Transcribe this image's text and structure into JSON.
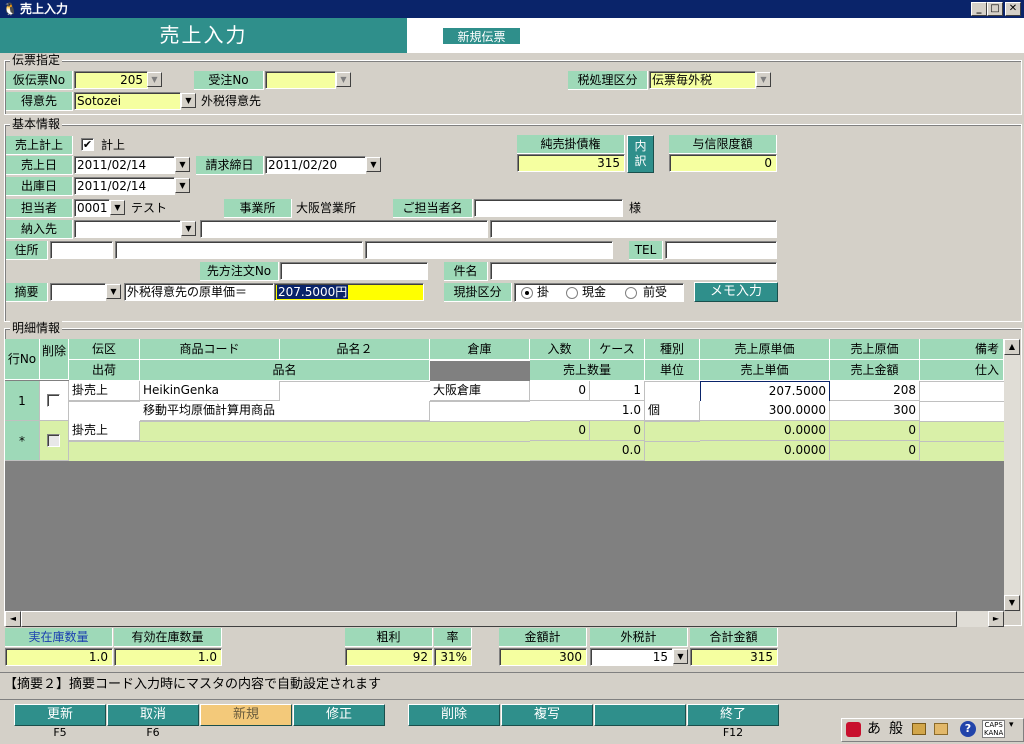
{
  "window": {
    "title": "売上入力",
    "minimize": "_",
    "restore": "□",
    "close": "✕"
  },
  "header": {
    "title": "売上入力",
    "new_badge": "新規伝票"
  },
  "denpyo": {
    "group": "伝票指定",
    "kari_no_label": "仮伝票No",
    "kari_no": "205",
    "juchu_label": "受注No",
    "juchu": "",
    "zei_label": "税処理区分",
    "zei": "伝票毎外税",
    "tokui_label": "得意先",
    "tokui": "Sotozei",
    "tokui_name": "外税得意先"
  },
  "kihon": {
    "group": "基本情報",
    "keijo_label": "売上計上",
    "keijo_check": "✔",
    "keijo_text": "計上",
    "junkake_label": "純売掛債権",
    "junkake": "315",
    "uchiwake": "内\n訳",
    "yoshin_label": "与信限度額",
    "yoshin": "0",
    "uriage_label": "売上日",
    "uriage": "2011/02/14",
    "seikyu_label": "請求締日",
    "seikyu": "2011/02/20",
    "shukko_label": "出庫日",
    "shukko": "2011/02/14",
    "tanto_label": "担当者",
    "tanto_code": "0001",
    "tanto_name": "テスト",
    "jigyo_label": "事業所",
    "jigyo": "大阪営業所",
    "gotanto_label": "ご担当者名",
    "gotanto": "",
    "sama": "様",
    "nonyu_label": "納入先",
    "jusho_label": "住所",
    "tel_label": "TEL",
    "sakichu_label": "先方注文No",
    "kenmei_label": "件名",
    "tekiyo_label": "摘要",
    "tekiyo_text": "外税得意先の原単価＝",
    "tekiyo_value": "207.5000円",
    "genkake_label": "現掛区分",
    "genkake_opts": [
      "掛",
      "現金",
      "前受"
    ],
    "memo_btn": "メモ入力"
  },
  "meisai": {
    "group": "明細情報",
    "hd": {
      "gyo": "行No",
      "sakujo": "削除",
      "denku": "伝区",
      "shohin": "商品コード",
      "hinmei2": "品名２",
      "soko": "倉庫",
      "irisu": "入数",
      "case": "ケース",
      "shubetsu": "種別",
      "genka_tanka": "売上原単価",
      "genka": "売上原価",
      "biko": "備考",
      "shukka": "出荷",
      "hinmei": "品名",
      "suryo": "売上数量",
      "tani": "単位",
      "tanka": "売上単価",
      "kingaku": "売上金額",
      "shiire": "仕入"
    },
    "rows": [
      {
        "no": "1",
        "denku": "掛売上",
        "code": "HeikinGenka",
        "soko": "大阪倉庫",
        "irisu": "0",
        "case": "1",
        "genka_tanka": "207.5000",
        "genka": "208",
        "hinmei": "移動平均原価計算用商品",
        "suryo": "1.0",
        "tani": "個",
        "tanka": "300.0000",
        "kingaku": "300"
      },
      {
        "no": "*",
        "denku": "掛売上",
        "irisu": "0",
        "case": "0",
        "genka_tanka": "0.0000",
        "genka": "0",
        "suryo": "0.0",
        "tanka": "0.0000",
        "kingaku": "0"
      }
    ]
  },
  "totals": {
    "jitsu_label": "実在庫数量",
    "jitsu": "1.0",
    "yuko_label": "有効在庫数量",
    "yuko": "1.0",
    "arari_label": "粗利",
    "arari": "92",
    "ritsu_label": "率",
    "ritsu": "31%",
    "kingaku_label": "金額計",
    "kingaku": "300",
    "sotozei_label": "外税計",
    "sotozei": "15",
    "gokei_label": "合計金額",
    "gokei": "315"
  },
  "status": "【摘要２】摘要コード入力時にマスタの内容で自動設定されます",
  "fkeys": [
    {
      "label": "更新",
      "key": "F5"
    },
    {
      "label": "取消",
      "key": "F6"
    },
    {
      "label": "新規",
      "key": ""
    },
    {
      "label": "修正",
      "key": ""
    },
    {
      "label": "削除",
      "key": ""
    },
    {
      "label": "複写",
      "key": ""
    },
    {
      "label": "",
      "key": ""
    },
    {
      "label": "終了",
      "key": "F12"
    }
  ],
  "tray": {
    "a": "あ",
    "han": "般",
    "caps": "CAPS",
    "kana": "KANA",
    "help": "?"
  },
  "icons": {
    "app": "app-icon",
    "scroll_left": "◄",
    "scroll_right": "►",
    "scroll_up": "▲",
    "scroll_down": "▼",
    "dropdown": "▼"
  }
}
